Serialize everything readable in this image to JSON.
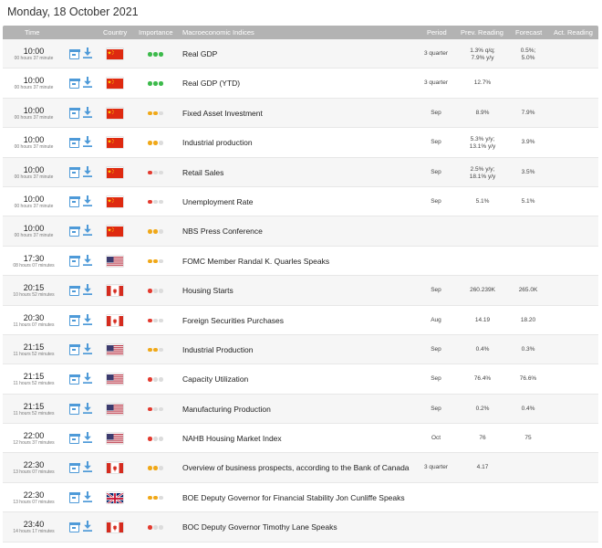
{
  "date_heading": "Monday, 18 October 2021",
  "columns": {
    "time": "Time",
    "country": "Country",
    "importance": "Importance",
    "indices": "Macroeconomic Indices",
    "period": "Period",
    "prev": "Prev. Reading",
    "forecast": "Forecast",
    "actual": "Act. Reading"
  },
  "colors": {
    "imp_high": "#3cba4b",
    "imp_medium": "#f0a818",
    "imp_low": "#e33a2f",
    "imp_empty": "#dcdcdc",
    "icon_blue": "#4e9ad8"
  },
  "events": [
    {
      "time": "10:00",
      "countdown": "00 hours 37 minute",
      "flag": "cn",
      "importance": 3,
      "name": "Real GDP",
      "period": "3 quarter",
      "prev": [
        "1.3% q/q;",
        "7.9% y/y"
      ],
      "forecast": [
        "0.5%;",
        "5.0%"
      ],
      "actual": ""
    },
    {
      "time": "10:00",
      "countdown": "00 hours 37 minute",
      "flag": "cn",
      "importance": 3,
      "name": "Real GDP (YTD)",
      "period": "3 quarter",
      "prev": [
        "12.7%"
      ],
      "forecast": [],
      "actual": ""
    },
    {
      "time": "10:00",
      "countdown": "00 hours 37 minute",
      "flag": "cn",
      "importance": 2,
      "name": "Fixed Asset Investment",
      "period": "Sep",
      "prev": [
        "8.9%"
      ],
      "forecast": [
        "7.9%"
      ],
      "actual": ""
    },
    {
      "time": "10:00",
      "countdown": "00 hours 37 minute",
      "flag": "cn",
      "importance": 2,
      "name": "Industrial production",
      "period": "Sep",
      "prev": [
        "5.3% y/y;",
        "13.1% y/y"
      ],
      "forecast": [
        "3.9%"
      ],
      "actual": ""
    },
    {
      "time": "10:00",
      "countdown": "00 hours 37 minute",
      "flag": "cn",
      "importance": 1,
      "name": "Retail Sales",
      "period": "Sep",
      "prev": [
        "2.5% y/y;",
        "18.1% y/y"
      ],
      "forecast": [
        "3.5%"
      ],
      "actual": ""
    },
    {
      "time": "10:00",
      "countdown": "00 hours 37 minute",
      "flag": "cn",
      "importance": 1,
      "name": "Unemployment Rate",
      "period": "Sep",
      "prev": [
        "5.1%"
      ],
      "forecast": [
        "5.1%"
      ],
      "actual": ""
    },
    {
      "time": "10:00",
      "countdown": "00 hours 37 minute",
      "flag": "cn",
      "importance": 2,
      "name": "NBS Press Conference",
      "period": "",
      "prev": [],
      "forecast": [],
      "actual": ""
    },
    {
      "time": "17:30",
      "countdown": "08 hours 07 minutes",
      "flag": "us",
      "importance": 2,
      "name": "FOMC Member Randal K. Quarles Speaks",
      "period": "",
      "prev": [],
      "forecast": [],
      "actual": ""
    },
    {
      "time": "20:15",
      "countdown": "10 hours 52 minutes",
      "flag": "ca",
      "importance": 1,
      "name": "Housing Starts",
      "period": "Sep",
      "prev": [
        "260.239K"
      ],
      "forecast": [
        "265.0K"
      ],
      "actual": ""
    },
    {
      "time": "20:30",
      "countdown": "11 hours 07 minutes",
      "flag": "ca",
      "importance": 1,
      "name": "Foreign Securities Purchases",
      "period": "Aug",
      "prev": [
        "14.19"
      ],
      "forecast": [
        "18.20"
      ],
      "actual": ""
    },
    {
      "time": "21:15",
      "countdown": "11 hours 52 minutes",
      "flag": "us",
      "importance": 2,
      "name": "Industrial Production",
      "period": "Sep",
      "prev": [
        "0.4%"
      ],
      "forecast": [
        "0.3%"
      ],
      "actual": ""
    },
    {
      "time": "21:15",
      "countdown": "11 hours 52 minutes",
      "flag": "us",
      "importance": 1,
      "name": "Capacity Utilization",
      "period": "Sep",
      "prev": [
        "76.4%"
      ],
      "forecast": [
        "76.6%"
      ],
      "actual": ""
    },
    {
      "time": "21:15",
      "countdown": "11 hours 52 minutes",
      "flag": "us",
      "importance": 1,
      "name": "Manufacturing Production",
      "period": "Sep",
      "prev": [
        "0.2%"
      ],
      "forecast": [
        "0.4%"
      ],
      "actual": ""
    },
    {
      "time": "22:00",
      "countdown": "12 hours 37 minutes",
      "flag": "us",
      "importance": 1,
      "name": "NAHB Housing Market Index",
      "period": "Oct",
      "prev": [
        "76"
      ],
      "forecast": [
        "75"
      ],
      "actual": ""
    },
    {
      "time": "22:30",
      "countdown": "13 hours 07 minutes",
      "flag": "ca",
      "importance": 2,
      "name": "Overview of business prospects, according to the Bank of Canada",
      "period": "3 quarter",
      "prev": [
        "4.17"
      ],
      "forecast": [],
      "actual": ""
    },
    {
      "time": "22:30",
      "countdown": "13 hours 07 minutes",
      "flag": "gb",
      "importance": 2,
      "name": "BOE Deputy Governor for Financial Stability Jon Cunliffe Speaks",
      "period": "",
      "prev": [],
      "forecast": [],
      "actual": ""
    },
    {
      "time": "23:40",
      "countdown": "14 hours 17 minutes",
      "flag": "ca",
      "importance": 1,
      "name": "BOC Deputy Governor Timothy Lane Speaks",
      "period": "",
      "prev": [],
      "forecast": [],
      "actual": ""
    }
  ]
}
